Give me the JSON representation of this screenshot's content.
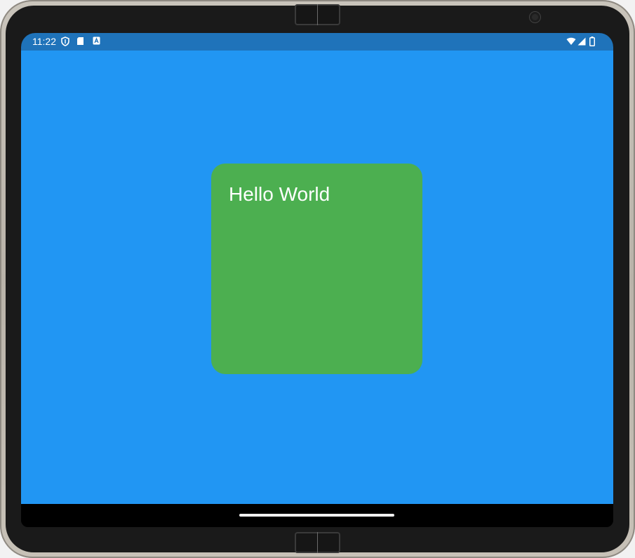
{
  "status_bar": {
    "time": "11:22",
    "left_icons": [
      "shield-icon",
      "sd-card-icon",
      "keyboard-a-icon"
    ],
    "right_icons": [
      "wifi-icon",
      "signal-icon",
      "battery-icon"
    ],
    "background_color": "#1f73ba"
  },
  "app": {
    "background_color": "#2196f3",
    "card": {
      "text": "Hello World",
      "background_color": "#4caf50",
      "text_color": "#ffffff"
    }
  },
  "navigation": {
    "gesture": "home-handle"
  }
}
